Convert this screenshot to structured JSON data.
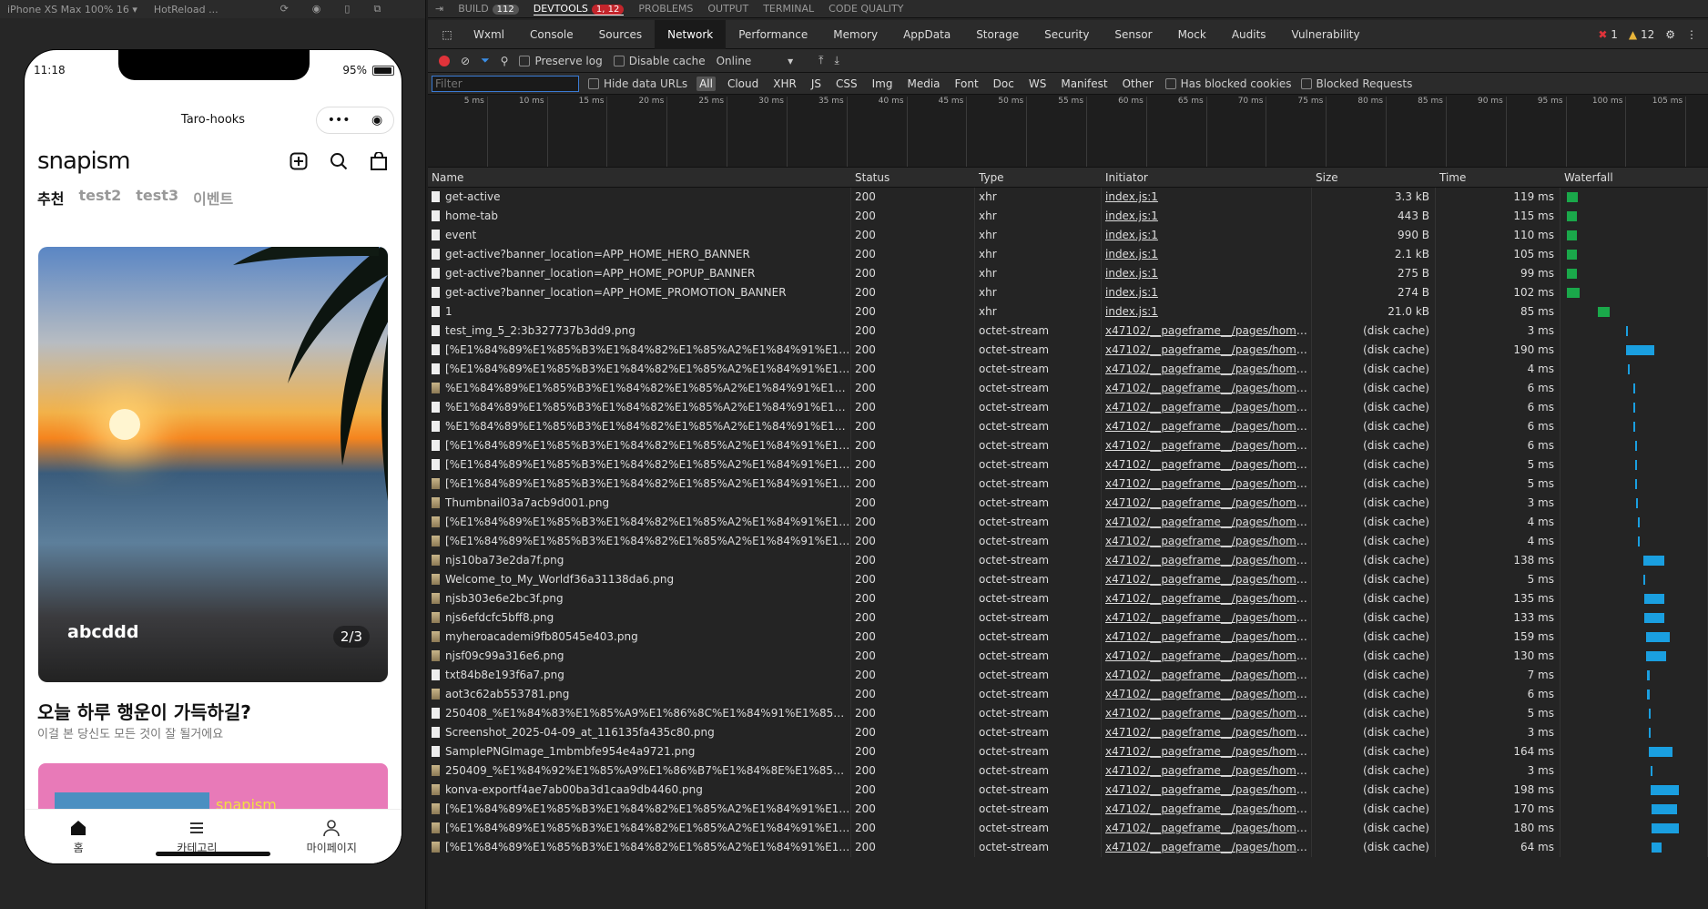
{
  "simulator": {
    "device_label": "iPhone XS Max 100% 16 ▾",
    "hotreload_label": "HotReload ..."
  },
  "phone": {
    "time": "11:18",
    "battery": "95%",
    "nav_title": "Taro-hooks",
    "logo": "snapism",
    "category_tabs": [
      "추천",
      "test2",
      "test3",
      "이벤트"
    ],
    "banner_title": "abcddd",
    "banner_counter": "2/3",
    "headline": "오늘 하루 행운이 가득하길?",
    "subline": "이걸 본 당신도 모든 것이 잘 될거에요",
    "promo_logo": "snapism",
    "tabbar": [
      "홈",
      "카테고리",
      "마이페이지"
    ]
  },
  "devtools": {
    "top_tabs": [
      {
        "label": "BUILD",
        "badge": "112"
      },
      {
        "label": "DEVTOOLS",
        "badge": "1, 12"
      },
      {
        "label": "PROBLEMS",
        "badge": ""
      },
      {
        "label": "OUTPUT",
        "badge": ""
      },
      {
        "label": "TERMINAL",
        "badge": ""
      },
      {
        "label": "CODE QUALITY",
        "badge": ""
      }
    ],
    "panel_tabs": [
      "Wxml",
      "Console",
      "Sources",
      "Network",
      "Performance",
      "Memory",
      "AppData",
      "Storage",
      "Security",
      "Sensor",
      "Mock",
      "Audits",
      "Vulnerability"
    ],
    "active_panel": "Network",
    "error_count": "1",
    "warning_count": "12",
    "toolbar": {
      "preserve_log": "Preserve log",
      "disable_cache": "Disable cache",
      "throttle": "Online"
    },
    "filter": {
      "placeholder": "Filter",
      "hide_data_urls": "Hide data URLs",
      "types": [
        "All",
        "Cloud",
        "XHR",
        "JS",
        "CSS",
        "Img",
        "Media",
        "Font",
        "Doc",
        "WS",
        "Manifest",
        "Other"
      ],
      "has_blocked": "Has blocked cookies",
      "blocked_requests": "Blocked Requests"
    },
    "timeline_ticks": [
      "5 ms",
      "10 ms",
      "15 ms",
      "20 ms",
      "25 ms",
      "30 ms",
      "35 ms",
      "40 ms",
      "45 ms",
      "50 ms",
      "55 ms",
      "60 ms",
      "65 ms",
      "70 ms",
      "75 ms",
      "80 ms",
      "85 ms",
      "90 ms",
      "95 ms",
      "100 ms",
      "105 ms"
    ],
    "columns": [
      "Name",
      "Status",
      "Type",
      "Initiator",
      "Size",
      "Time",
      "Waterfall"
    ],
    "rows": [
      {
        "name": "get-active",
        "status": "200",
        "type": "xhr",
        "initiator": "index.js:1",
        "size": "3.3 kB",
        "time": "119 ms",
        "wf_start": 0.02,
        "wf_len": 0.08,
        "wf_color": "#1aa84a",
        "icon": "file"
      },
      {
        "name": "home-tab",
        "status": "200",
        "type": "xhr",
        "initiator": "index.js:1",
        "size": "443 B",
        "time": "115 ms",
        "wf_start": 0.02,
        "wf_len": 0.07,
        "wf_color": "#1aa84a",
        "icon": "file"
      },
      {
        "name": "event",
        "status": "200",
        "type": "xhr",
        "initiator": "index.js:1",
        "size": "990 B",
        "time": "110 ms",
        "wf_start": 0.02,
        "wf_len": 0.07,
        "wf_color": "#1aa84a",
        "icon": "file"
      },
      {
        "name": "get-active?banner_location=APP_HOME_HERO_BANNER",
        "status": "200",
        "type": "xhr",
        "initiator": "index.js:1",
        "size": "2.1 kB",
        "time": "105 ms",
        "wf_start": 0.02,
        "wf_len": 0.07,
        "wf_color": "#1aa84a",
        "icon": "file"
      },
      {
        "name": "get-active?banner_location=APP_HOME_POPUP_BANNER",
        "status": "200",
        "type": "xhr",
        "initiator": "index.js:1",
        "size": "275 B",
        "time": "99 ms",
        "wf_start": 0.02,
        "wf_len": 0.07,
        "wf_color": "#1aa84a",
        "icon": "file"
      },
      {
        "name": "get-active?banner_location=APP_HOME_PROMOTION_BANNER",
        "status": "200",
        "type": "xhr",
        "initiator": "index.js:1",
        "size": "274 B",
        "time": "102 ms",
        "wf_start": 0.02,
        "wf_len": 0.09,
        "wf_color": "#1aa84a",
        "icon": "file"
      },
      {
        "name": "1",
        "status": "200",
        "type": "xhr",
        "initiator": "index.js:1",
        "size": "21.0 kB",
        "time": "85 ms",
        "wf_start": 0.24,
        "wf_len": 0.08,
        "wf_color": "#1aa84a",
        "icon": "file"
      },
      {
        "name": "test_img_5_2:3b327737b3dd9.png",
        "status": "200",
        "type": "octet-stream",
        "initiator": "x47102/__pageframe__/pages/home/ind...",
        "size": "(disk cache)",
        "time": "3 ms",
        "wf_start": 0.44,
        "wf_len": 0.01,
        "wf_color": "#1a9fe0",
        "icon": "file"
      },
      {
        "name": "[%E1%84%89%E1%85%B3%E1%84%82%E1%85%A2%E1%84%91%E1%...8F%E1...",
        "status": "200",
        "type": "octet-stream",
        "initiator": "x47102/__pageframe__/pages/home/ind...",
        "size": "(disk cache)",
        "time": "190 ms",
        "wf_start": 0.44,
        "wf_len": 0.2,
        "wf_color": "#1a9fe0",
        "icon": "file"
      },
      {
        "name": "[%E1%84%89%E1%85%B3%E1%84%82%E1%85%A2%E1%84%91%E1%...8F%E1...",
        "status": "200",
        "type": "octet-stream",
        "initiator": "x47102/__pageframe__/pages/home/ind...",
        "size": "(disk cache)",
        "time": "4 ms",
        "wf_start": 0.45,
        "wf_len": 0.01,
        "wf_color": "#1a9fe0",
        "icon": "file"
      },
      {
        "name": "%E1%84%89%E1%85%B3%E1%84%82%E1%85%A2%E1%84%91%E1%8...8F%...",
        "status": "200",
        "type": "octet-stream",
        "initiator": "x47102/__pageframe__/pages/home/ind...",
        "size": "(disk cache)",
        "time": "6 ms",
        "wf_start": 0.49,
        "wf_len": 0.015,
        "wf_color": "#1a9fe0",
        "icon": "img"
      },
      {
        "name": "%E1%84%89%E1%85%B3%E1%84%82%E1%85%A2%E1%84%91%E1%8...8F%...",
        "status": "200",
        "type": "octet-stream",
        "initiator": "x47102/__pageframe__/pages/home/ind...",
        "size": "(disk cache)",
        "time": "6 ms",
        "wf_start": 0.49,
        "wf_len": 0.015,
        "wf_color": "#1a9fe0",
        "icon": "file"
      },
      {
        "name": "%E1%84%89%E1%85%B3%E1%84%82%E1%85%A2%E1%84%91%E1%8...8F%...",
        "status": "200",
        "type": "octet-stream",
        "initiator": "x47102/__pageframe__/pages/home/ind...",
        "size": "(disk cache)",
        "time": "6 ms",
        "wf_start": 0.49,
        "wf_len": 0.015,
        "wf_color": "#1a9fe0",
        "icon": "file"
      },
      {
        "name": "[%E1%84%89%E1%85%B3%E1%84%82%E1%85%A2%E1%84%91%E1%...8F%E1...",
        "status": "200",
        "type": "octet-stream",
        "initiator": "x47102/__pageframe__/pages/home/ind...",
        "size": "(disk cache)",
        "time": "6 ms",
        "wf_start": 0.5,
        "wf_len": 0.015,
        "wf_color": "#1a9fe0",
        "icon": "file"
      },
      {
        "name": "[%E1%84%89%E1%85%B3%E1%84%82%E1%85%A2%E1%84%91%E1%...%8F%E...",
        "status": "200",
        "type": "octet-stream",
        "initiator": "x47102/__pageframe__/pages/home/ind...",
        "size": "(disk cache)",
        "time": "5 ms",
        "wf_start": 0.5,
        "wf_len": 0.015,
        "wf_color": "#1a9fe0",
        "icon": "file"
      },
      {
        "name": "[%E1%84%89%E1%85%B3%E1%84%82%E1%85%A2%E1%84%91%E1%...%92%E...",
        "status": "200",
        "type": "octet-stream",
        "initiator": "x47102/__pageframe__/pages/home/ind...",
        "size": "(disk cache)",
        "time": "5 ms",
        "wf_start": 0.5,
        "wf_len": 0.015,
        "wf_color": "#1a9fe0",
        "icon": "img"
      },
      {
        "name": "Thumbnail03a7acb9d001.png",
        "status": "200",
        "type": "octet-stream",
        "initiator": "x47102/__pageframe__/pages/home/ind...",
        "size": "(disk cache)",
        "time": "3 ms",
        "wf_start": 0.51,
        "wf_len": 0.01,
        "wf_color": "#1a9fe0",
        "icon": "img"
      },
      {
        "name": "[%E1%84%89%E1%85%B3%E1%84%82%E1%85%A2%E1%84%91%E1%...2%E1%...",
        "status": "200",
        "type": "octet-stream",
        "initiator": "x47102/__pageframe__/pages/home/ind...",
        "size": "(disk cache)",
        "time": "4 ms",
        "wf_start": 0.52,
        "wf_len": 0.01,
        "wf_color": "#1a9fe0",
        "icon": "img"
      },
      {
        "name": "[%E1%84%89%E1%85%B3%E1%84%82%E1%85%A2%E1%84%91%E1%...2%E1%...",
        "status": "200",
        "type": "octet-stream",
        "initiator": "x47102/__pageframe__/pages/home/ind...",
        "size": "(disk cache)",
        "time": "4 ms",
        "wf_start": 0.52,
        "wf_len": 0.01,
        "wf_color": "#1a9fe0",
        "icon": "img"
      },
      {
        "name": "njs10ba73e2da7f.png",
        "status": "200",
        "type": "octet-stream",
        "initiator": "x47102/__pageframe__/pages/home/ind...",
        "size": "(disk cache)",
        "time": "138 ms",
        "wf_start": 0.56,
        "wf_len": 0.15,
        "wf_color": "#1a9fe0",
        "icon": "img"
      },
      {
        "name": "Welcome_to_My_Worldf36a31138da6.png",
        "status": "200",
        "type": "octet-stream",
        "initiator": "x47102/__pageframe__/pages/home/ind...",
        "size": "(disk cache)",
        "time": "5 ms",
        "wf_start": 0.56,
        "wf_len": 0.015,
        "wf_color": "#1a9fe0",
        "icon": "img"
      },
      {
        "name": "njsb303e6e2bc3f.png",
        "status": "200",
        "type": "octet-stream",
        "initiator": "x47102/__pageframe__/pages/home/ind...",
        "size": "(disk cache)",
        "time": "135 ms",
        "wf_start": 0.57,
        "wf_len": 0.14,
        "wf_color": "#1a9fe0",
        "icon": "img"
      },
      {
        "name": "njs6efdcfc5bff8.png",
        "status": "200",
        "type": "octet-stream",
        "initiator": "x47102/__pageframe__/pages/home/ind...",
        "size": "(disk cache)",
        "time": "133 ms",
        "wf_start": 0.57,
        "wf_len": 0.14,
        "wf_color": "#1a9fe0",
        "icon": "img"
      },
      {
        "name": "myheroacademi9fb80545e403.png",
        "status": "200",
        "type": "octet-stream",
        "initiator": "x47102/__pageframe__/pages/home/ind...",
        "size": "(disk cache)",
        "time": "159 ms",
        "wf_start": 0.58,
        "wf_len": 0.17,
        "wf_color": "#1a9fe0",
        "icon": "img"
      },
      {
        "name": "njsf09c99a316e6.png",
        "status": "200",
        "type": "octet-stream",
        "initiator": "x47102/__pageframe__/pages/home/ind...",
        "size": "(disk cache)",
        "time": "130 ms",
        "wf_start": 0.58,
        "wf_len": 0.14,
        "wf_color": "#1a9fe0",
        "icon": "img"
      },
      {
        "name": "txt84b8e193f6a7.png",
        "status": "200",
        "type": "octet-stream",
        "initiator": "x47102/__pageframe__/pages/home/ind...",
        "size": "(disk cache)",
        "time": "7 ms",
        "wf_start": 0.59,
        "wf_len": 0.015,
        "wf_color": "#1a9fe0",
        "icon": "file"
      },
      {
        "name": "aot3c62ab553781.png",
        "status": "200",
        "type": "octet-stream",
        "initiator": "x47102/__pageframe__/pages/home/ind...",
        "size": "(disk cache)",
        "time": "6 ms",
        "wf_start": 0.59,
        "wf_len": 0.015,
        "wf_color": "#1a9fe0",
        "icon": "img"
      },
      {
        "name": "250408_%E1%84%83%E1%85%A9%E1%86%8C%E1%84%91%E1%85%...%85%A...",
        "status": "200",
        "type": "octet-stream",
        "initiator": "x47102/__pageframe__/pages/home/ind...",
        "size": "(disk cache)",
        "time": "5 ms",
        "wf_start": 0.6,
        "wf_len": 0.015,
        "wf_color": "#1a9fe0",
        "icon": "file"
      },
      {
        "name": "Screenshot_2025-04-09_at_116135fa435c80.png",
        "status": "200",
        "type": "octet-stream",
        "initiator": "x47102/__pageframe__/pages/home/ind...",
        "size": "(disk cache)",
        "time": "3 ms",
        "wf_start": 0.6,
        "wf_len": 0.01,
        "wf_color": "#1a9fe0",
        "icon": "file"
      },
      {
        "name": "SamplePNGImage_1mbmbfe954e4a9721.png",
        "status": "200",
        "type": "octet-stream",
        "initiator": "x47102/__pageframe__/pages/home/ind...",
        "size": "(disk cache)",
        "time": "164 ms",
        "wf_start": 0.6,
        "wf_len": 0.17,
        "wf_color": "#1a9fe0",
        "icon": "file"
      },
      {
        "name": "250409_%E1%84%92%E1%85%A9%E1%86%B7%E1%84%8E%E1%85%...%84%85...",
        "status": "200",
        "type": "octet-stream",
        "initiator": "x47102/__pageframe__/pages/home/ind...",
        "size": "(disk cache)",
        "time": "3 ms",
        "wf_start": 0.61,
        "wf_len": 0.01,
        "wf_color": "#1a9fe0",
        "icon": "img"
      },
      {
        "name": "konva-exportf4ae7ab00ba3d1caa9db4460.png",
        "status": "200",
        "type": "octet-stream",
        "initiator": "x47102/__pageframe__/pages/home/ind...",
        "size": "(disk cache)",
        "time": "198 ms",
        "wf_start": 0.61,
        "wf_len": 0.2,
        "wf_color": "#1a9fe0",
        "icon": "img"
      },
      {
        "name": "[%E1%84%89%E1%85%B3%E1%84%82%E1%85%A2%E1%84%91%E1%...92%E1...",
        "status": "200",
        "type": "octet-stream",
        "initiator": "x47102/__pageframe__/pages/home/ind...",
        "size": "(disk cache)",
        "time": "170 ms",
        "wf_start": 0.62,
        "wf_len": 0.18,
        "wf_color": "#1a9fe0",
        "icon": "img"
      },
      {
        "name": "[%E1%84%89%E1%85%B3%E1%84%82%E1%85%A2%E1%84%91%E1%...92%E1...",
        "status": "200",
        "type": "octet-stream",
        "initiator": "x47102/__pageframe__/pages/home/ind...",
        "size": "(disk cache)",
        "time": "180 ms",
        "wf_start": 0.62,
        "wf_len": 0.19,
        "wf_color": "#1a9fe0",
        "icon": "img"
      },
      {
        "name": "[%E1%84%89%E1%85%B3%E1%84%82%E1%85%A2%E1%84%91%E1%...%87%8...",
        "status": "200",
        "type": "octet-stream",
        "initiator": "x47102/__pageframe__/pages/home/ind...",
        "size": "(disk cache)",
        "time": "64 ms",
        "wf_start": 0.62,
        "wf_len": 0.07,
        "wf_color": "#1a9fe0",
        "icon": "img"
      }
    ]
  }
}
